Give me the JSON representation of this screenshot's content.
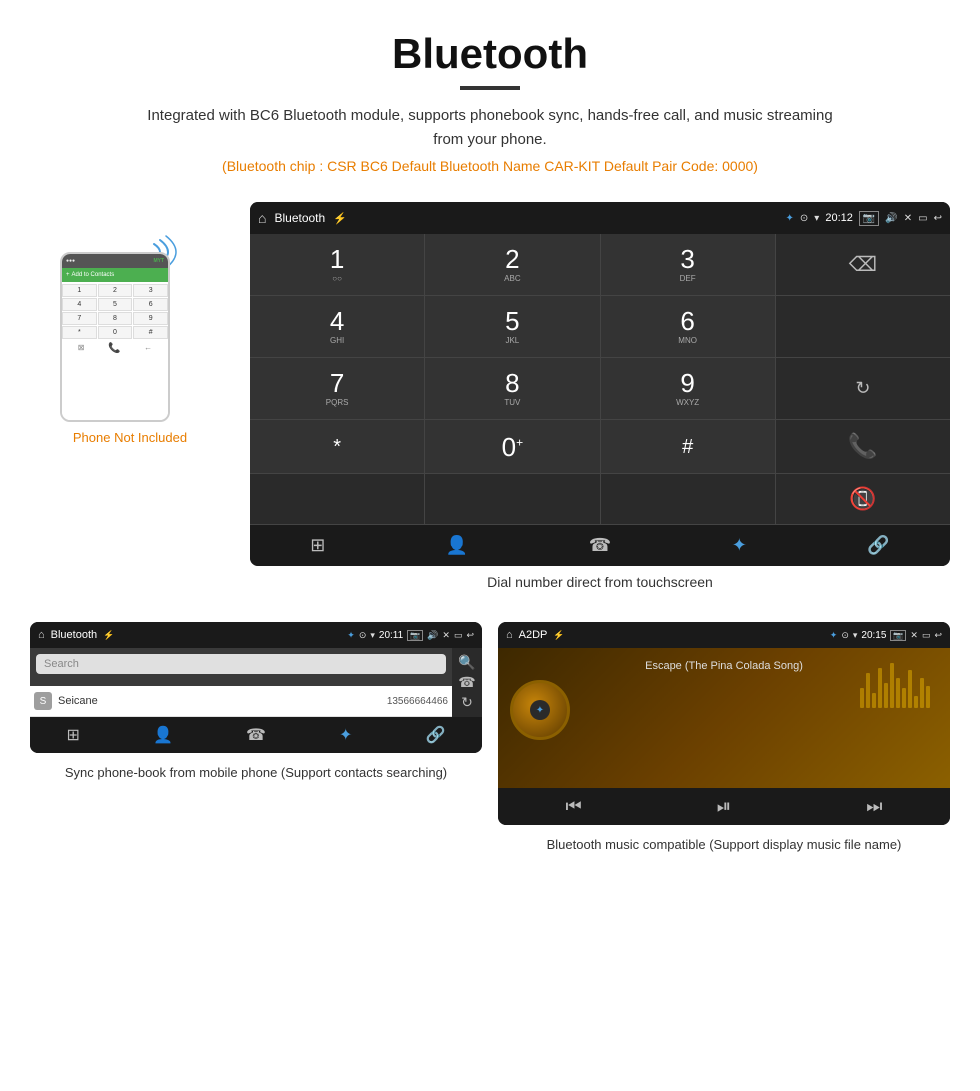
{
  "header": {
    "title": "Bluetooth",
    "description": "Integrated with BC6 Bluetooth module, supports phonebook sync, hands-free call, and music streaming from your phone.",
    "specs": "(Bluetooth chip : CSR BC6    Default Bluetooth Name CAR-KIT    Default Pair Code: 0000)"
  },
  "phone": {
    "not_included_label": "Phone Not Included"
  },
  "dial_screen": {
    "title": "Bluetooth",
    "time": "20:12",
    "caption": "Dial number direct from touchscreen",
    "keys": [
      {
        "num": "1",
        "letters": ""
      },
      {
        "num": "2",
        "letters": "ABC"
      },
      {
        "num": "3",
        "letters": "DEF"
      },
      {
        "num": "",
        "letters": ""
      },
      {
        "num": "4",
        "letters": "GHI"
      },
      {
        "num": "5",
        "letters": "JKL"
      },
      {
        "num": "6",
        "letters": "MNO"
      },
      {
        "num": "",
        "letters": ""
      },
      {
        "num": "7",
        "letters": "PQRS"
      },
      {
        "num": "8",
        "letters": "TUV"
      },
      {
        "num": "9",
        "letters": "WXYZ"
      },
      {
        "num": "",
        "letters": "reload"
      },
      {
        "num": "*",
        "letters": ""
      },
      {
        "num": "0",
        "letters": "+"
      },
      {
        "num": "#",
        "letters": ""
      },
      {
        "num": "",
        "letters": ""
      }
    ]
  },
  "phonebook_panel": {
    "title": "Bluetooth",
    "time": "20:11",
    "search_placeholder": "Search",
    "contact_name": "Seicane",
    "contact_number": "13566664466",
    "contact_letter": "S",
    "caption": "Sync phone-book from mobile phone\n(Support contacts searching)"
  },
  "music_panel": {
    "title": "A2DP",
    "time": "20:15",
    "song_title": "Escape (The Pina Colada Song)",
    "caption": "Bluetooth music compatible\n(Support display music file name)"
  },
  "colors": {
    "accent_orange": "#e87d00",
    "dark_bg": "#2a2a2a",
    "darker_bg": "#1a1a1a",
    "green_call": "#4caf50",
    "red_hangup": "#f44336",
    "blue_bt": "#4a9ede"
  }
}
